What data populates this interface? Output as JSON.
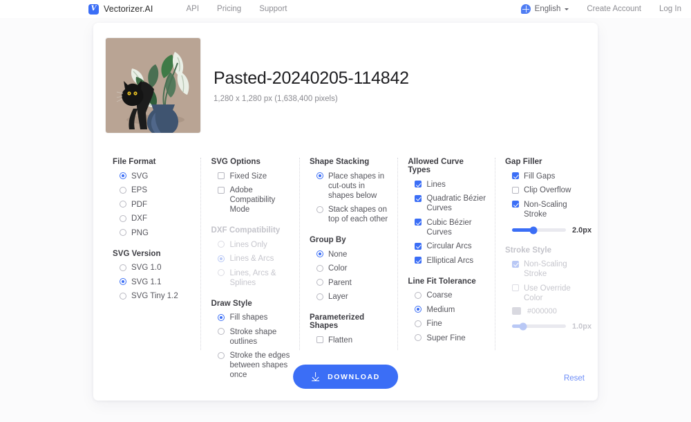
{
  "header": {
    "brand_mark": "vectorizer-logo",
    "brand_name": "Vectorizer.AI",
    "nav": [
      {
        "label": "API"
      },
      {
        "label": "Pricing"
      },
      {
        "label": "Support"
      }
    ],
    "language": {
      "icon": "globe-icon",
      "label": "English"
    },
    "create_account": "Create Account",
    "log_in": "Log In"
  },
  "file": {
    "title": "Pasted-20240205-114842",
    "dimensions": "1,280 x 1,280 px (1,638,400 pixels)",
    "thumbnail_alt": "black-cat-with-monstera-plant-illustration"
  },
  "options": {
    "col1": [
      {
        "title": "File Format",
        "type": "radio",
        "disabled": false,
        "items": [
          {
            "label": "SVG",
            "checked": true
          },
          {
            "label": "EPS",
            "checked": false
          },
          {
            "label": "PDF",
            "checked": false
          },
          {
            "label": "DXF",
            "checked": false
          },
          {
            "label": "PNG",
            "checked": false
          }
        ]
      },
      {
        "title": "SVG Version",
        "type": "radio",
        "disabled": false,
        "items": [
          {
            "label": "SVG 1.0",
            "checked": false
          },
          {
            "label": "SVG 1.1",
            "checked": true
          },
          {
            "label": "SVG Tiny 1.2",
            "checked": false
          }
        ]
      }
    ],
    "col2": [
      {
        "title": "SVG Options",
        "type": "check",
        "disabled": false,
        "items": [
          {
            "label": "Fixed Size",
            "checked": false
          },
          {
            "label": "Adobe Compatibility Mode",
            "checked": false
          }
        ]
      },
      {
        "title": "DXF Compatibility",
        "type": "radio",
        "disabled": true,
        "items": [
          {
            "label": "Lines Only",
            "checked": false
          },
          {
            "label": "Lines & Arcs",
            "checked": true
          },
          {
            "label": "Lines, Arcs & Splines",
            "checked": false
          }
        ]
      },
      {
        "title": "Draw Style",
        "type": "radio",
        "disabled": false,
        "items": [
          {
            "label": "Fill shapes",
            "checked": true
          },
          {
            "label": "Stroke shape outlines",
            "checked": false
          },
          {
            "label": "Stroke the edges between shapes once",
            "checked": false
          }
        ]
      }
    ],
    "col3": [
      {
        "title": "Shape Stacking",
        "type": "radio",
        "disabled": false,
        "items": [
          {
            "label": "Place shapes in cut-outs in shapes below",
            "checked": true
          },
          {
            "label": "Stack shapes on top of each other",
            "checked": false
          }
        ]
      },
      {
        "title": "Group By",
        "type": "radio",
        "disabled": false,
        "items": [
          {
            "label": "None",
            "checked": true
          },
          {
            "label": "Color",
            "checked": false
          },
          {
            "label": "Parent",
            "checked": false
          },
          {
            "label": "Layer",
            "checked": false
          }
        ]
      },
      {
        "title": "Parameterized Shapes",
        "type": "check",
        "disabled": false,
        "items": [
          {
            "label": "Flatten",
            "checked": false
          }
        ]
      }
    ],
    "col4": [
      {
        "title": "Allowed Curve Types",
        "type": "check",
        "disabled": false,
        "items": [
          {
            "label": "Lines",
            "checked": true
          },
          {
            "label": "Quadratic Bézier Curves",
            "checked": true
          },
          {
            "label": "Cubic Bézier Curves",
            "checked": true
          },
          {
            "label": "Circular Arcs",
            "checked": true
          },
          {
            "label": "Elliptical Arcs",
            "checked": true
          }
        ]
      },
      {
        "title": "Line Fit Tolerance",
        "type": "radio",
        "disabled": false,
        "items": [
          {
            "label": "Coarse",
            "checked": false
          },
          {
            "label": "Medium",
            "checked": true
          },
          {
            "label": "Fine",
            "checked": false
          },
          {
            "label": "Super Fine",
            "checked": false
          }
        ]
      }
    ],
    "col5": [
      {
        "title": "Gap Filler",
        "type": "check",
        "disabled": false,
        "items": [
          {
            "label": "Fill Gaps",
            "checked": true
          },
          {
            "label": "Clip Overflow",
            "checked": false
          },
          {
            "label": "Non-Scaling Stroke",
            "checked": true
          }
        ],
        "slider": {
          "value": "2.0px",
          "percent": 40
        }
      },
      {
        "title": "Stroke Style",
        "type": "check",
        "disabled": true,
        "items": [
          {
            "label": "Non-Scaling Stroke",
            "checked": true
          },
          {
            "label": "Use Override Color",
            "checked": false
          }
        ],
        "color": {
          "hex": "#000000"
        },
        "slider": {
          "value": "1.0px",
          "percent": 20
        }
      }
    ]
  },
  "footer": {
    "download_label": "DOWNLOAD",
    "download_icon": "download-icon",
    "reset_label": "Reset"
  },
  "colors": {
    "accent": "#3b6ef6",
    "link": "#6d8df7",
    "page_bg": "#fbfbfc",
    "card_bg": "#ffffff"
  }
}
